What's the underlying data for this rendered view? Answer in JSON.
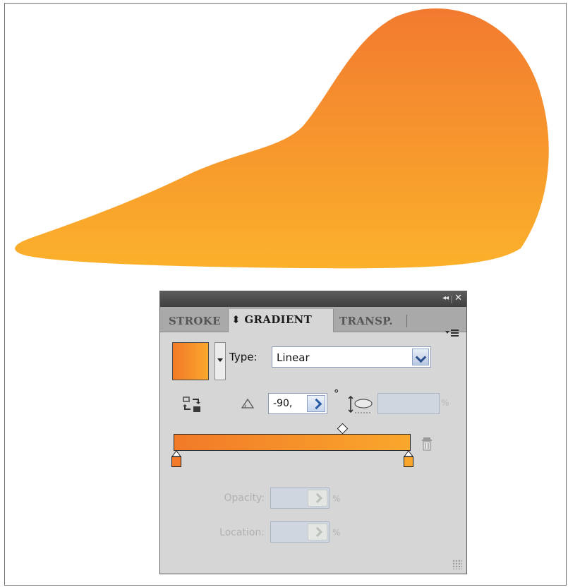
{
  "panel": {
    "tabs": [
      {
        "label": "STROKE"
      },
      {
        "label": "⬍ GRADIENT"
      },
      {
        "label": "TRANSP."
      }
    ],
    "collapse_glyph": "◂◂",
    "close_glyph": "✕",
    "type_label": "Type:",
    "type_value": "Linear",
    "angle_value": "-90,",
    "degree_symbol": "°",
    "aspect_value": "",
    "aspect_unit": "%",
    "opacity_label": "Opacity:",
    "opacity_value": "",
    "opacity_unit": "%",
    "location_label": "Location:",
    "location_value": "",
    "location_unit": "%"
  },
  "gradient": {
    "start_color": "#f27a28",
    "end_color": "#f9a72c",
    "angle": -90
  },
  "shape": {
    "fill_top": "#f27a2f",
    "fill_bottom": "#fbb12b"
  },
  "icons": {
    "panel_menu": "panel-menu-icon",
    "reverse": "reverse-gradient-icon",
    "angle": "angle-icon",
    "aspect": "aspect-ratio-icon",
    "trash": "trash-icon",
    "stop": "color-stop-icon"
  }
}
